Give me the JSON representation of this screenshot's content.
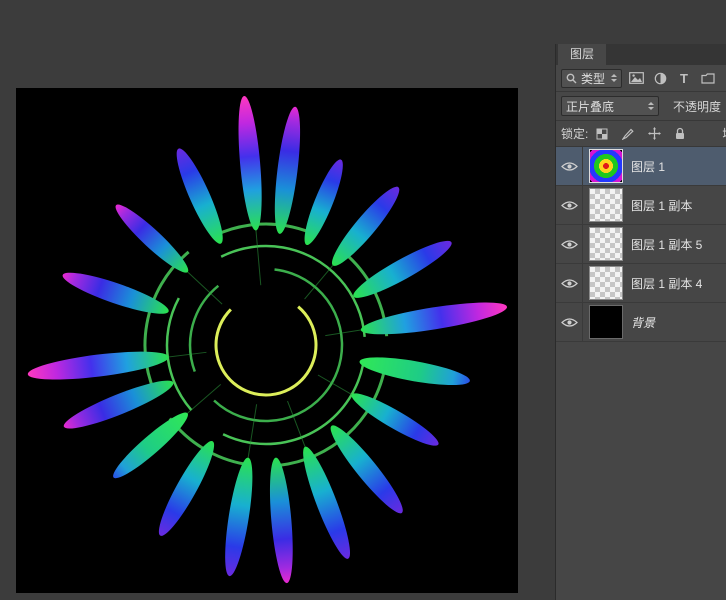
{
  "panel": {
    "tab": "图层",
    "filter": {
      "type_label": "类型"
    },
    "blend": {
      "mode": "正片叠底",
      "opacity_label": "不透明度"
    },
    "lock": {
      "label": "锁定:",
      "fill_label": "填充"
    }
  },
  "layers": {
    "items": [
      {
        "name": "图层 1",
        "selected": true,
        "thumb": "rainbow"
      },
      {
        "name": "图层 1 副本",
        "selected": false,
        "thumb": "checker"
      },
      {
        "name": "图层 1 副本 5",
        "selected": false,
        "thumb": "checker"
      },
      {
        "name": "图层 1 副本 4",
        "selected": false,
        "thumb": "checker"
      },
      {
        "name": "背景",
        "selected": false,
        "thumb": "black"
      }
    ]
  },
  "icons": {
    "type_tool": "T"
  },
  "colors": {
    "selected_row": "#4e5c6e",
    "panel_bg": "#464646",
    "canvas_bg": "#000000"
  }
}
